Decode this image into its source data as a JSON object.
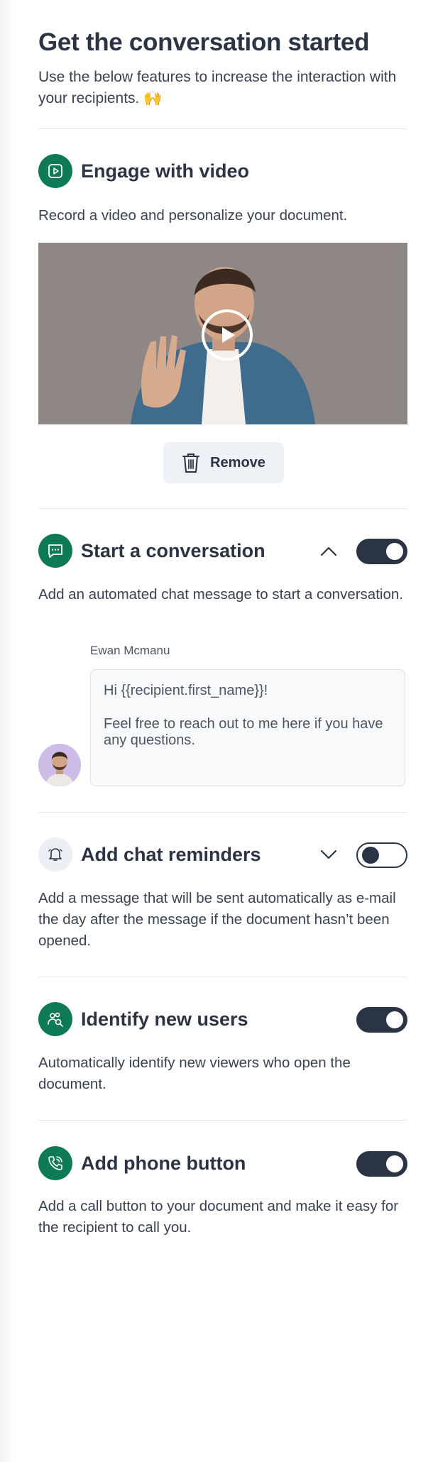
{
  "header": {
    "title": "Get the conversation started",
    "intro": "Use the below features to increase the interaction with your recipients. 🙌"
  },
  "video_section": {
    "title": "Engage with video",
    "description": "Record a video and personalize your document.",
    "remove_label": "Remove",
    "icon": "play-icon"
  },
  "conversation_section": {
    "title": "Start a conversation",
    "description": "Add an automated chat message to start a conversation.",
    "enabled": true,
    "expanded": true,
    "sender_name": "Ewan Mcmanu",
    "message_line1": "Hi {{recipient.first_name}}!",
    "message_line2": "Feel free to reach out to me here if you have any questions.",
    "icon": "chat-icon"
  },
  "reminders_section": {
    "title": "Add chat reminders",
    "description": "Add a message that will be sent automatically as e-mail the day after the message if the document hasn’t been opened.",
    "enabled": false,
    "expanded": false,
    "icon": "bell-icon"
  },
  "identify_section": {
    "title": "Identify new users",
    "description": "Automatically identify new viewers who open the document.",
    "enabled": true,
    "icon": "users-search-icon"
  },
  "phone_section": {
    "title": "Add phone button",
    "description": "Add a call button to your document and make it easy for the recipient to call you.",
    "enabled": true,
    "icon": "phone-icon"
  },
  "colors": {
    "accent": "#0f7a58",
    "toggle_on": "#2b3444",
    "text": "#2c3443"
  }
}
